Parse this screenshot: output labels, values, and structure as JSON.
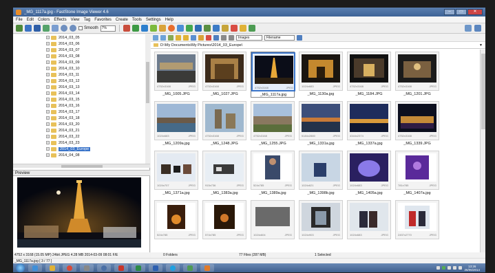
{
  "window": {
    "title": "_MG_1117a.jpg - FastStone Image Viewer 4.6",
    "buttons": [
      "–",
      "▭",
      "✕"
    ]
  },
  "menu": [
    "File",
    "Edit",
    "Colors",
    "Effects",
    "View",
    "Tag",
    "Favorites",
    "Create",
    "Tools",
    "Settings",
    "Help"
  ],
  "toolbar": {
    "smooth_label": "Smooth",
    "zoom_value": "7%"
  },
  "tree": {
    "items": [
      "2014_03_05",
      "2014_03_06",
      "2014_03_07",
      "2014_03_08",
      "2014_03_09",
      "2014_03_10",
      "2014_03_11",
      "2014_03_12",
      "2014_03_13",
      "2014_03_14",
      "2014_03_15",
      "2014_03_16",
      "2014_03_17",
      "2014_03_18",
      "2014_03_20",
      "2014_03_21",
      "2014_03_22",
      "2014_03_23",
      "2014_03_Europe",
      "2014_04_08"
    ],
    "selected_index": 18
  },
  "preview": {
    "label": "Preview"
  },
  "navbar": {
    "filter_value": "Images",
    "sort_value": "Filename"
  },
  "path": "D:\\My Documents\\My Pictures\\2014_03_Europe\\",
  "thumbnails": [
    {
      "name": "_MG_1005.JPG",
      "dims": "4752x3168",
      "type": "JPEG",
      "scene": "bridge"
    },
    {
      "name": "_MG_1027.JPG",
      "dims": "4752x3168",
      "type": "JPEG",
      "scene": "hall"
    },
    {
      "name": "_MG_1117a.jpg",
      "dims": "4752x3168",
      "type": "JPEG",
      "scene": "tower"
    },
    {
      "name": "_MG_1130a.jpg",
      "dims": "1024x683",
      "type": "JPEG",
      "scene": "arch"
    },
    {
      "name": "_MG_1184.JPG",
      "dims": "4752x3168",
      "type": "JPEG",
      "scene": "tunnel"
    },
    {
      "name": "_MG_1201.JPG",
      "dims": "4752x3168",
      "type": "JPEG",
      "scene": "crowd"
    },
    {
      "name": "_MG_1209a.jpg",
      "dims": "1024x683",
      "type": "JPEG",
      "scene": "river"
    },
    {
      "name": "_MG_1248.JPG",
      "dims": "4752x3168",
      "type": "JPEG",
      "scene": "castle"
    },
    {
      "name": "_MG_1255.JPG",
      "dims": "4752x3168",
      "type": "JPEG",
      "scene": "palace"
    },
    {
      "name": "_MG_1331a.jpg",
      "dims": "5184x2880",
      "type": "JPEG",
      "scene": "harbor"
    },
    {
      "name": "_MG_1337a.jpg",
      "dims": "4344x2374",
      "type": "JPEG",
      "scene": "citynight"
    },
    {
      "name": "_MG_1339.JPG",
      "dims": "4752x3168",
      "type": "JPEG",
      "scene": "lights"
    },
    {
      "name": "_MG_1371a.jpg",
      "dims": "1024x707",
      "type": "JPEG",
      "scene": "dogs"
    },
    {
      "name": "_MG_1383a.jpg",
      "dims": "915x736",
      "type": "JPEG",
      "scene": "husky"
    },
    {
      "name": "_MG_1389a.jpg",
      "dims": "524x785",
      "type": "JPEG",
      "scene": "person"
    },
    {
      "name": "_MG_1398b.jpg",
      "dims": "1024x621",
      "type": "JPEG",
      "scene": "snow"
    },
    {
      "name": "_MG_1405a.jpg",
      "dims": "1024x683",
      "type": "JPEG",
      "scene": "ice"
    },
    {
      "name": "_MG_1407a.jpg",
      "dims": "781x785",
      "type": "JPEG",
      "scene": "purple"
    },
    {
      "name": "",
      "dims": "524x785",
      "type": "JPEG",
      "scene": "cave"
    },
    {
      "name": "",
      "dims": "574x785",
      "type": "JPEG",
      "scene": "cave2"
    },
    {
      "name": "",
      "dims": "1024x604",
      "type": "JPEG",
      "scene": "grey"
    },
    {
      "name": "",
      "dims": "1024x903",
      "type": "JPEG",
      "scene": "bw"
    },
    {
      "name": "",
      "dims": "1024x683",
      "type": "JPEG",
      "scene": "couple"
    },
    {
      "name": "",
      "dims": "2457x2770",
      "type": "JPEG",
      "scene": "redcoat"
    }
  ],
  "status": {
    "image_info": "4752 x 3168 (15.05 MP) 24bit JPEG 4.28 MB 2014-03-09 08:01 F/E",
    "image_pos": "_MG_1117a.jpg [ 3 / 77 ]",
    "folders": "0 Folders",
    "files": "77 Files (287 MB)",
    "selected": "1 Selected"
  },
  "taskbar": {
    "time": "13:26",
    "date": "26/06/2014"
  }
}
